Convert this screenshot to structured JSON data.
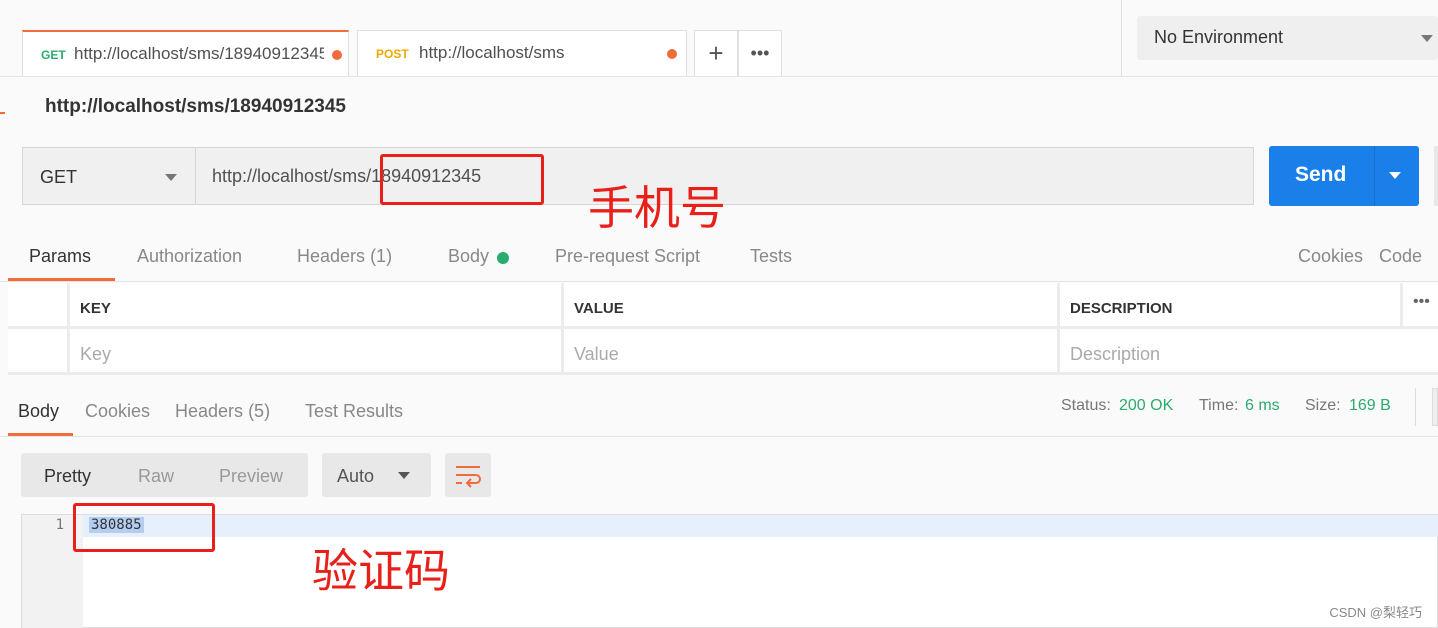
{
  "tabs": [
    {
      "method": "GET",
      "url": "http://localhost/sms/18940912345",
      "method_color": "#2bab6d"
    },
    {
      "method": "POST",
      "url": "http://localhost/sms",
      "method_color": "#f2a700"
    }
  ],
  "tab_actions": {
    "add_icon": "+",
    "more_icon": "•••"
  },
  "environment": {
    "selected": "No Environment"
  },
  "request": {
    "title": "http://localhost/sms/18940912345",
    "method": "GET",
    "url_prefix": "http://localhost/sms/",
    "url_number": "18940912345",
    "send_label": "Send"
  },
  "annotations": {
    "phone": "手机号",
    "code": "验证码"
  },
  "request_tabs": {
    "params": "Params",
    "authorization": "Authorization",
    "headers": "Headers",
    "headers_count": "(1)",
    "body": "Body",
    "prerequest": "Pre-request Script",
    "tests": "Tests",
    "cookies": "Cookies",
    "code": "Code"
  },
  "params_table": {
    "headers": {
      "key": "KEY",
      "value": "VALUE",
      "description": "DESCRIPTION"
    },
    "placeholders": {
      "key": "Key",
      "value": "Value",
      "description": "Description"
    }
  },
  "response_tabs": {
    "body": "Body",
    "cookies": "Cookies",
    "headers": "Headers",
    "headers_count": "(5)",
    "test_results": "Test Results"
  },
  "response_status": {
    "status_label": "Status:",
    "status_value": "200 OK",
    "time_label": "Time:",
    "time_value": "6 ms",
    "size_label": "Size:",
    "size_value": "169 B"
  },
  "view_modes": {
    "pretty": "Pretty",
    "raw": "Raw",
    "preview": "Preview",
    "format": "Auto"
  },
  "response_body": {
    "line_number": "1",
    "content": "380885"
  },
  "watermark": "CSDN @梨轻巧",
  "colors": {
    "accent": "#f26b3a",
    "send": "#1a7fe8",
    "success": "#2bab6d",
    "annotation": "#e8201a"
  }
}
